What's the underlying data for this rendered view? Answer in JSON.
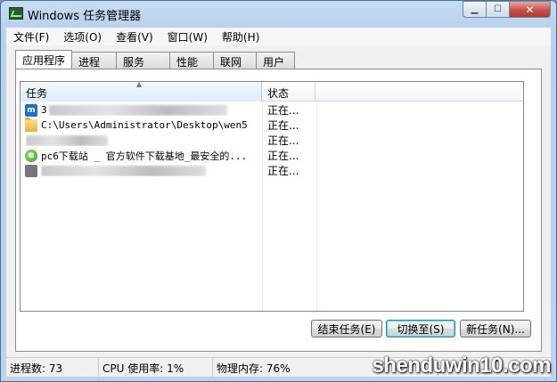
{
  "window": {
    "title": "Windows 任务管理器"
  },
  "menu": [
    "文件(F)",
    "选项(O)",
    "查看(V)",
    "窗口(W)",
    "帮助(H)"
  ],
  "tabs": [
    "应用程序",
    "进程",
    "服务",
    "性能",
    "联网",
    "用户"
  ],
  "active_tab": 0,
  "list": {
    "columns": {
      "task": "任务",
      "status": "状态"
    },
    "rows": [
      {
        "icon": "browser-icon",
        "task": "3",
        "status": "正在..."
      },
      {
        "icon": "folder-icon",
        "task": "C:\\Users\\Administrator\\Desktop\\wen5",
        "status": "正在..."
      },
      {
        "icon": "",
        "task": "",
        "status": "正在..."
      },
      {
        "icon": "ie-icon",
        "task": "pc6下载站 _ 官方软件下载基地_最安全的...",
        "status": "正在..."
      },
      {
        "icon": "app-icon",
        "task": "",
        "status": "正在..."
      }
    ]
  },
  "buttons": {
    "end_task": "结束任务(E)",
    "switch_to": "切换至(S)",
    "new_task": "新任务(N)..."
  },
  "statusbar": {
    "processes": "进程数: 73",
    "cpu": "CPU 使用率: 1%",
    "memory": "物理内存: 76%"
  },
  "watermark": "shenduwin10.com",
  "colors": {
    "titlebar": "#b9d1ea",
    "close_button": "#c75050",
    "selected_column": "#dcecfc"
  }
}
